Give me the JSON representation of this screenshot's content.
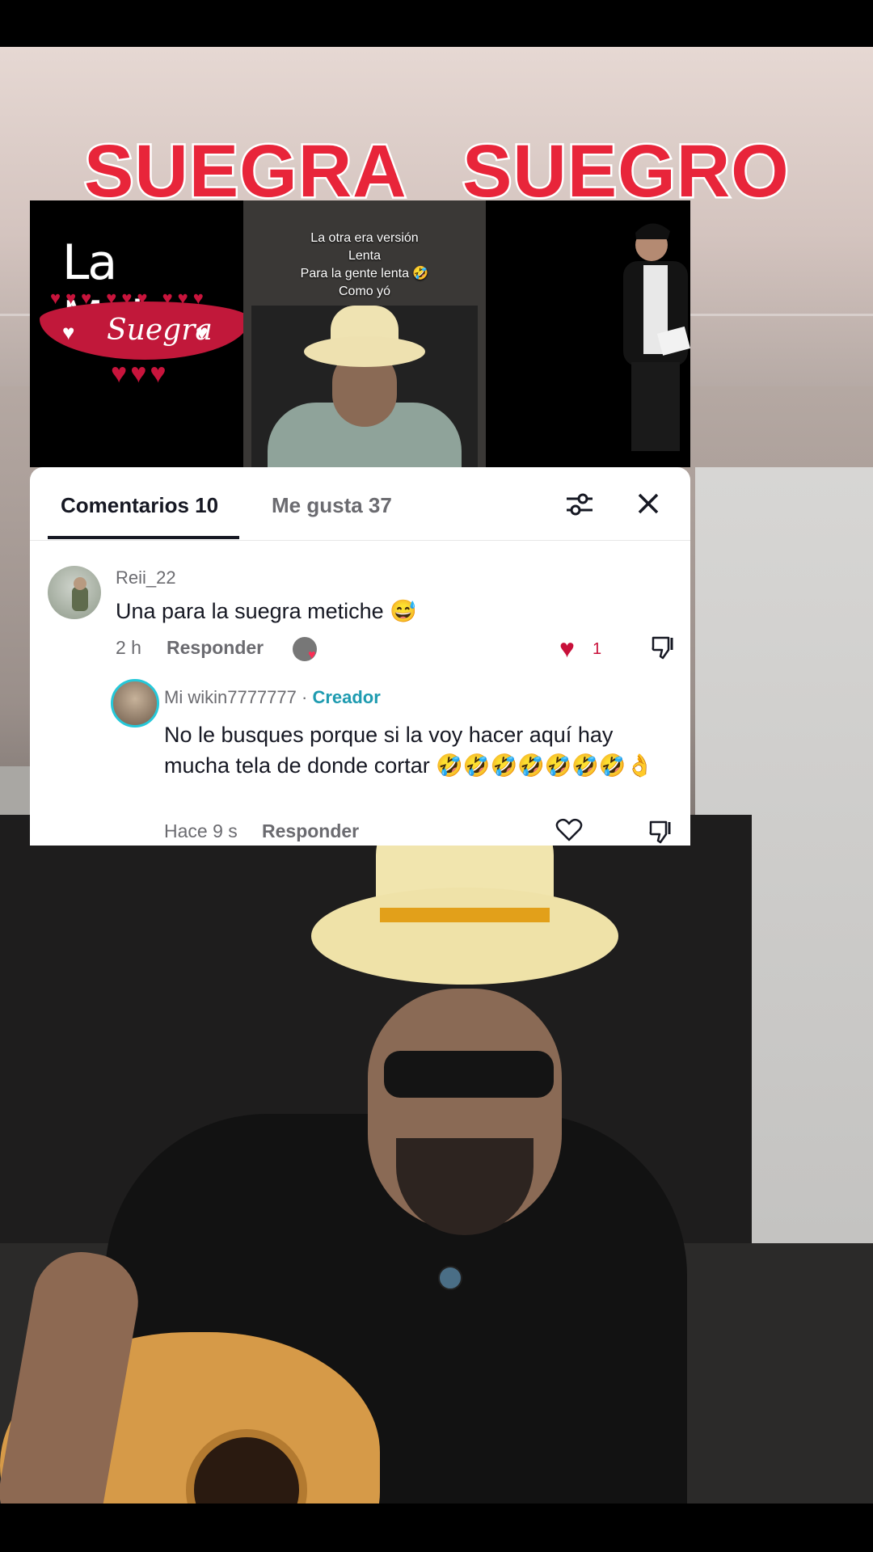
{
  "overlay": {
    "title_left": "SUEGRA",
    "title_right": "SUEGRO",
    "left_image": {
      "heading": "La Mejor",
      "ribbon": "Suegra"
    },
    "middle_caption": [
      "La otra era versión",
      "Lenta",
      "Para la gente lenta 🤣",
      "Como yó"
    ]
  },
  "comments_panel": {
    "tabs": [
      {
        "label": "Comentarios 10",
        "active": true
      },
      {
        "label": "Me gusta 37",
        "active": false
      }
    ],
    "comments": [
      {
        "username": "Reii_22",
        "text": "Una para la suegra metiche 😅",
        "time": "2 h",
        "reply_label": "Responder",
        "likes": "1",
        "liked": true
      }
    ],
    "reply": {
      "username": "Mi wikin7777777",
      "separator": "·",
      "badge": "Creador",
      "text": "No le busques porque si la voy hacer aquí hay mucha tela de donde cortar 🤣🤣🤣🤣🤣🤣🤣👌",
      "time": "Hace 9 s",
      "reply_label": "Responder"
    }
  },
  "colors": {
    "title_red": "#e8253a",
    "like_red": "#c8103a",
    "creator_teal": "#1e9bb0"
  },
  "icons": {
    "filter": "filter-sliders-icon",
    "close": "close-icon",
    "like": "heart-icon",
    "dislike": "thumbs-down-icon"
  }
}
